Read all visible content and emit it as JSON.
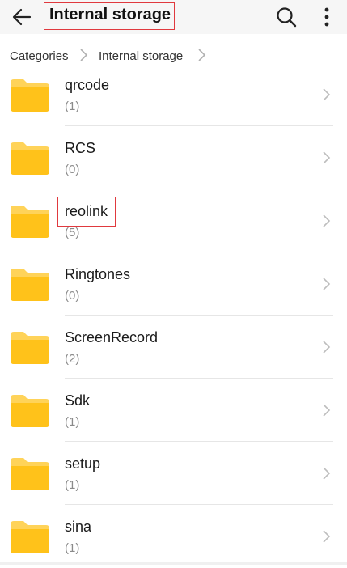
{
  "header": {
    "title": "Internal storage",
    "back_icon": "back-arrow-icon",
    "search_icon": "search-icon",
    "more_icon": "more-vertical-icon"
  },
  "breadcrumb": {
    "items": [
      "Categories",
      "Internal storage"
    ]
  },
  "folders": [
    {
      "name": "qrcode",
      "count": "(1)"
    },
    {
      "name": "RCS",
      "count": "(0)"
    },
    {
      "name": "reolink",
      "count": "(5)"
    },
    {
      "name": "Ringtones",
      "count": "(0)"
    },
    {
      "name": "ScreenRecord",
      "count": "(2)"
    },
    {
      "name": "Sdk",
      "count": "(1)"
    },
    {
      "name": "setup",
      "count": "(1)"
    },
    {
      "name": "sina",
      "count": "(1)"
    }
  ],
  "colors": {
    "folder": "#FFC21A",
    "folder_tab": "#FFD359",
    "highlight": "#E0393E"
  }
}
